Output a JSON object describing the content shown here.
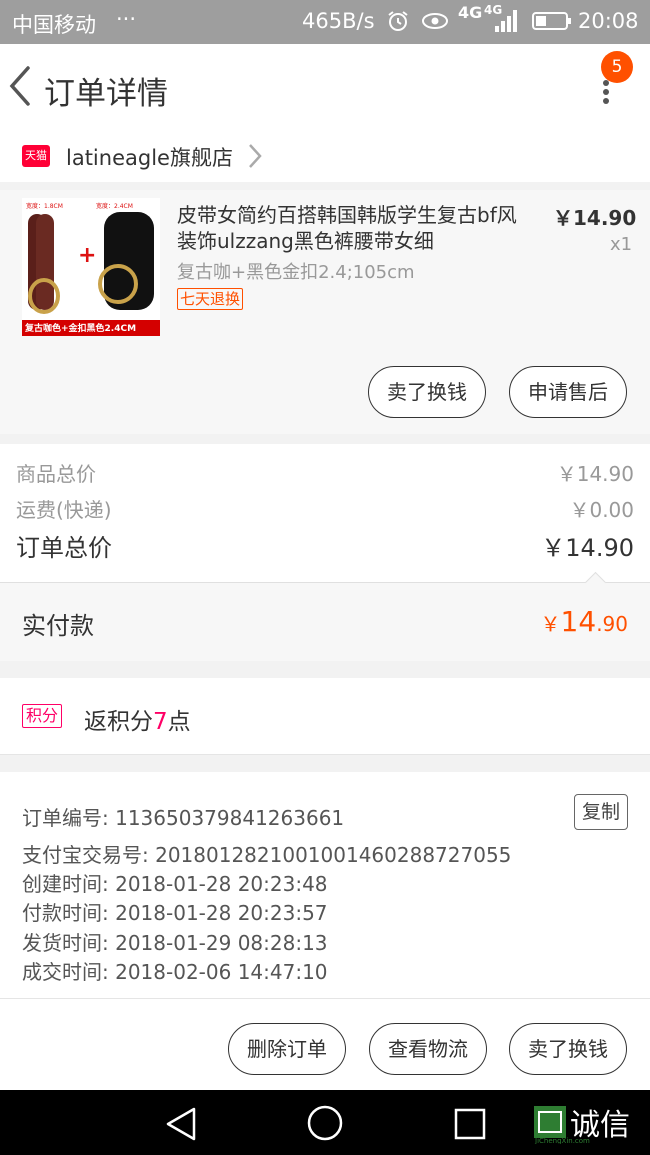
{
  "status_bar": {
    "carrier": "中国移动",
    "more": "···",
    "speed": "465B/s",
    "network_1": "4G",
    "network_2": "4G",
    "time": "20:08"
  },
  "header": {
    "title": "订单详情",
    "badge": "5"
  },
  "store": {
    "platform_badge": "天猫",
    "name": "latineagle旗舰店"
  },
  "product": {
    "image_labels": {
      "width_left": "宽度：1.8CM",
      "width_right": "宽度：2.4CM",
      "plus": "+",
      "caption": "复古咖色+金扣黑色2.4CM"
    },
    "title": "皮带女简约百搭韩国韩版学生复古bf风装饰ulzzang黑色裤腰带女细",
    "sku": "复古咖+黑色金扣2.4;105cm",
    "return_tag": "七天退换",
    "price": "￥14.90",
    "quantity": "x1",
    "buttons": {
      "sell": "卖了换钱",
      "after_sale": "申请售后"
    }
  },
  "summary": {
    "goods_label": "商品总价",
    "goods_value": "￥14.90",
    "shipping_label": "运费(快递)",
    "shipping_value": "￥0.00",
    "order_total_label": "订单总价",
    "order_total_value": "￥14.90",
    "paid_label": "实付款",
    "paid_currency": "￥",
    "paid_integer": "14",
    "paid_decimal": ".90"
  },
  "points": {
    "tag": "积分",
    "prefix": "返积分",
    "value": "7",
    "suffix": "点"
  },
  "info": {
    "copy_label": "复制",
    "rows": [
      {
        "label": "订单编号:",
        "value": "113650379841263661"
      },
      {
        "label": "支付宝交易号:",
        "value": "2018012821001001460288727055"
      },
      {
        "label": "创建时间:",
        "value": "2018-01-28 20:23:48"
      },
      {
        "label": "付款时间:",
        "value": "2018-01-28 20:23:57"
      },
      {
        "label": "发货时间:",
        "value": "2018-01-29 08:28:13"
      },
      {
        "label": "成交时间:",
        "value": "2018-02-06 14:47:10"
      }
    ]
  },
  "actions": {
    "delete": "删除订单",
    "logistics": "查看物流",
    "sell": "卖了换钱"
  },
  "watermark": {
    "text": "诚信",
    "sub": "JiChengXin.com"
  },
  "colors": {
    "accent": "#ff5000",
    "points": "#ff0066",
    "tmall": "#ff0036"
  }
}
